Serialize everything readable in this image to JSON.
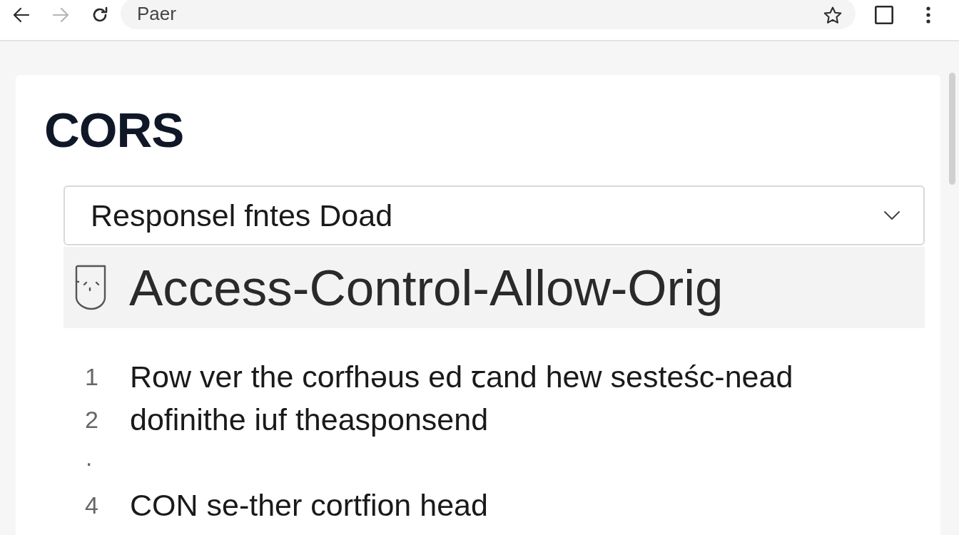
{
  "toolbar": {
    "nav_buttons": [
      {
        "kind": "back",
        "disabled": false
      },
      {
        "kind": "forward",
        "disabled": true
      },
      {
        "kind": "reload",
        "disabled": false
      }
    ],
    "address": {
      "value": "Paer"
    },
    "actions": [
      {
        "kind": "star"
      },
      {
        "kind": "square"
      },
      {
        "kind": "menu"
      }
    ]
  },
  "page": {
    "heading": "CORS",
    "dropdown": {
      "value": "Responsel fntes Doad",
      "expanded": false
    },
    "header_row": {
      "text": "Access-Control-Allow-Orig",
      "selected": true
    },
    "lines": [
      {
        "number": "1",
        "text": "Row ver the corfhəus ed ꞇand hew sesteśc-nead"
      },
      {
        "number": "2",
        "text": "dofinithe iuf theasponsend"
      },
      {
        "number": "·"
      },
      {
        "number": "4",
        "text": "CON se-ther cortfion head"
      }
    ]
  }
}
